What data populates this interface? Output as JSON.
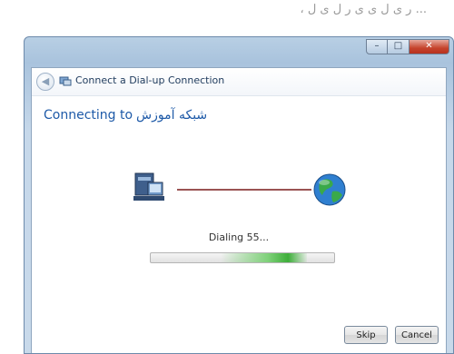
{
  "page": {
    "caption": "... ر ی ل ی ی ر ل ی ل ،"
  },
  "window": {
    "title": "Connect a Dial-up Connection",
    "caption_buttons": {
      "minimize": "–",
      "maximize": "□",
      "close": "✕"
    },
    "heading_prefix": "Connecting to",
    "heading_name": "شبکه آموزش",
    "status_text": "Dialing 55...",
    "progress": 0.85,
    "buttons": {
      "skip": "Skip",
      "cancel": "Cancel"
    }
  },
  "icons": {
    "back": "back-arrow-icon",
    "nav": "dialup-connection-icon",
    "computer": "computer-icon",
    "globe": "globe-icon"
  },
  "colors": {
    "heading": "#1e5aa8",
    "line": "#7a1a1a",
    "progress": "#3eae3a",
    "close": "#c5432c"
  }
}
